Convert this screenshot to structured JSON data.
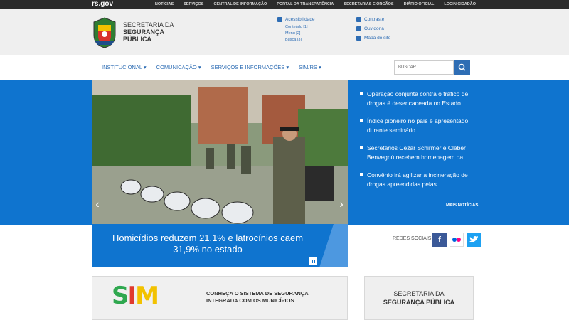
{
  "topbar": {
    "brand": "rs.gov",
    "links": [
      "NOTÍCIAS",
      "SERVIÇOS",
      "CENTRAL DE INFORMAÇÃO",
      "PORTAL DA TRANSPARÊNCIA",
      "SECRETARIAS E ÓRGÃOS",
      "DIÁRIO OFICIAL",
      "LOGIN CIDADÃO"
    ]
  },
  "header": {
    "site_line1": "SECRETARIA DA",
    "site_line2": "SEGURANÇA",
    "site_line3": "PÚBLICA",
    "accessibility": "Acessibilidade",
    "acc_links": [
      "Conteúdo [1]",
      "Menu [2]",
      "Busca [3]"
    ],
    "contrast": "Contraste",
    "ouvidoria": "Ouvidoria",
    "sitemap": "Mapa do site"
  },
  "nav": {
    "items": [
      "INSTITUCIONAL ▾",
      "COMUNICAÇÃO ▾",
      "SERVIÇOS E INFORMAÇÕES ▾",
      "SIM/RS ▾"
    ],
    "search_placeholder": "BUSCAR"
  },
  "news": {
    "items": [
      "Operação conjunta contra o tráfico de drogas é desencadeada no Estado",
      "Índice pioneiro no país é apresentado durante seminário",
      "Secretários Cezar Schirmer e Cleber Benvegnú recebem homenagem da...",
      "Convênio irá agilizar a incineração de drogas apreendidas pelas..."
    ],
    "more": "MAIS NOTÍCIAS"
  },
  "slide": {
    "caption": "Homicídios reduzem 21,1% e latrocínios caem 31,9% no estado"
  },
  "social": {
    "label": "REDES SOCIAIS",
    "networks": [
      "facebook",
      "flickr",
      "twitter"
    ]
  },
  "banners": {
    "sim_logo": "SIM",
    "sim_line1": "CONHEÇA O SISTEMA DE SEGURANÇA",
    "sim_line2": "INTEGRADA COM OS MUNICÍPIOS",
    "secr_line1": "SECRETARIA DA",
    "secr_line2": "SEGURANÇA PÚBLICA"
  },
  "colors": {
    "accent": "#0f74cf",
    "link": "#2e6db4",
    "topbar": "#2b2b2b",
    "facebook": "#3b5998",
    "flickr": "#ffffff",
    "twitter": "#1da1f2"
  }
}
